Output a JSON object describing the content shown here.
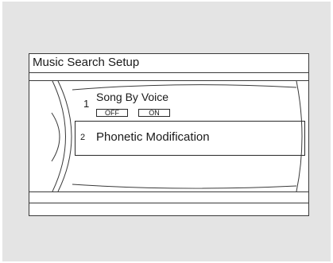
{
  "screen": {
    "title": "Music Search Setup"
  },
  "menu": {
    "items": [
      {
        "number": "1",
        "label": "Song By Voice",
        "options": [
          {
            "label": "OFF"
          },
          {
            "label": "ON"
          }
        ]
      },
      {
        "number": "2",
        "label": "Phonetic Modification",
        "selected": true
      }
    ]
  },
  "colors": {
    "bezel": "#e4e4e4",
    "screen": "#ffffff",
    "line": "#3a3a3a"
  }
}
